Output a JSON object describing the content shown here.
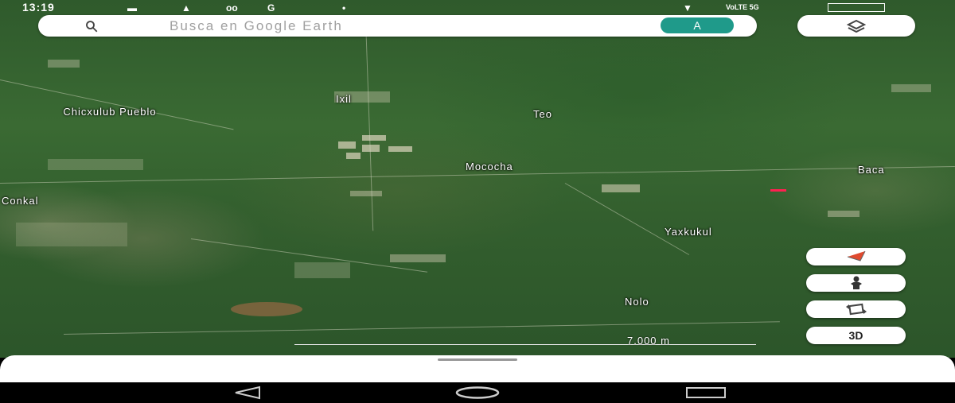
{
  "status_bar": {
    "time": "13:19",
    "network": "VoLTE 5G"
  },
  "search": {
    "placeholder": "Busca en Google Earth",
    "account_initial": "A"
  },
  "map": {
    "places": [
      "Chicxulub Pueblo",
      "Ixil",
      "Teo",
      "Mococha",
      "Baca",
      "Conkal",
      "Yaxkukul",
      "Nolo"
    ],
    "scale": "7.000 m"
  },
  "controls": {
    "threed_label": "3D"
  },
  "colors": {
    "accent": "#1f9a8a"
  },
  "icons": {
    "search": "search-icon",
    "layers": "layers-icon",
    "compass": "compass-icon",
    "street_view": "pegman-icon",
    "rotate": "rotate-icon",
    "back": "nav-back-icon",
    "home": "nav-home-icon",
    "recents": "nav-recents-icon"
  }
}
